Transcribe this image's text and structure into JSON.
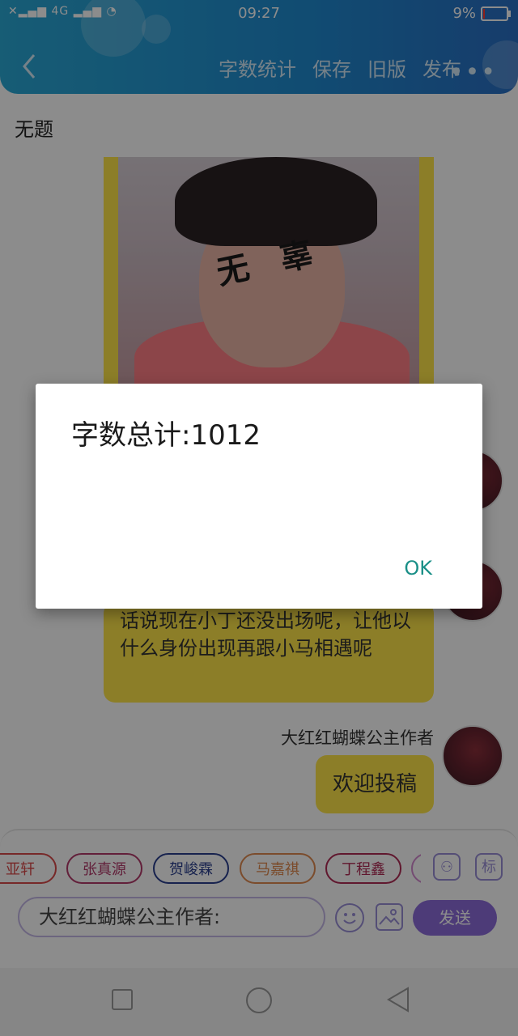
{
  "status_bar": {
    "network": "4G",
    "time": "09:27",
    "battery": "9%",
    "battery_level": 0.09
  },
  "header": {
    "actions": [
      "字数统计",
      "保存",
      "旧版",
      "发布"
    ]
  },
  "document": {
    "title": "无题",
    "image_caption": "无辜"
  },
  "messages": [
    {
      "text": "话说现在小丁还没出场呢，让他以什么身份出现再跟小马相遇呢"
    },
    {
      "author": "大红红蝴蝶公主作者",
      "text": "欢迎投稿"
    }
  ],
  "input_area": {
    "tags": [
      {
        "label": "亚轩",
        "color": "#d94a4a"
      },
      {
        "label": "张真源",
        "color": "#b23a6a"
      },
      {
        "label": "贺峻霖",
        "color": "#2a3f8f"
      },
      {
        "label": "马嘉祺",
        "color": "#e08a50"
      },
      {
        "label": "丁程鑫",
        "color": "#b02a55"
      }
    ],
    "tool_buttons": [
      "标"
    ],
    "input_value": "大红红蝴蝶公主作者:",
    "send_label": "发送"
  },
  "dialog": {
    "message": "字数总计:1012",
    "ok_label": "OK"
  },
  "colors": {
    "header_blue": "#1f8ad0",
    "bubble_yellow": "#ffe64a",
    "accent_purple": "#8c6cdb",
    "ok_teal": "#1a8f87"
  }
}
